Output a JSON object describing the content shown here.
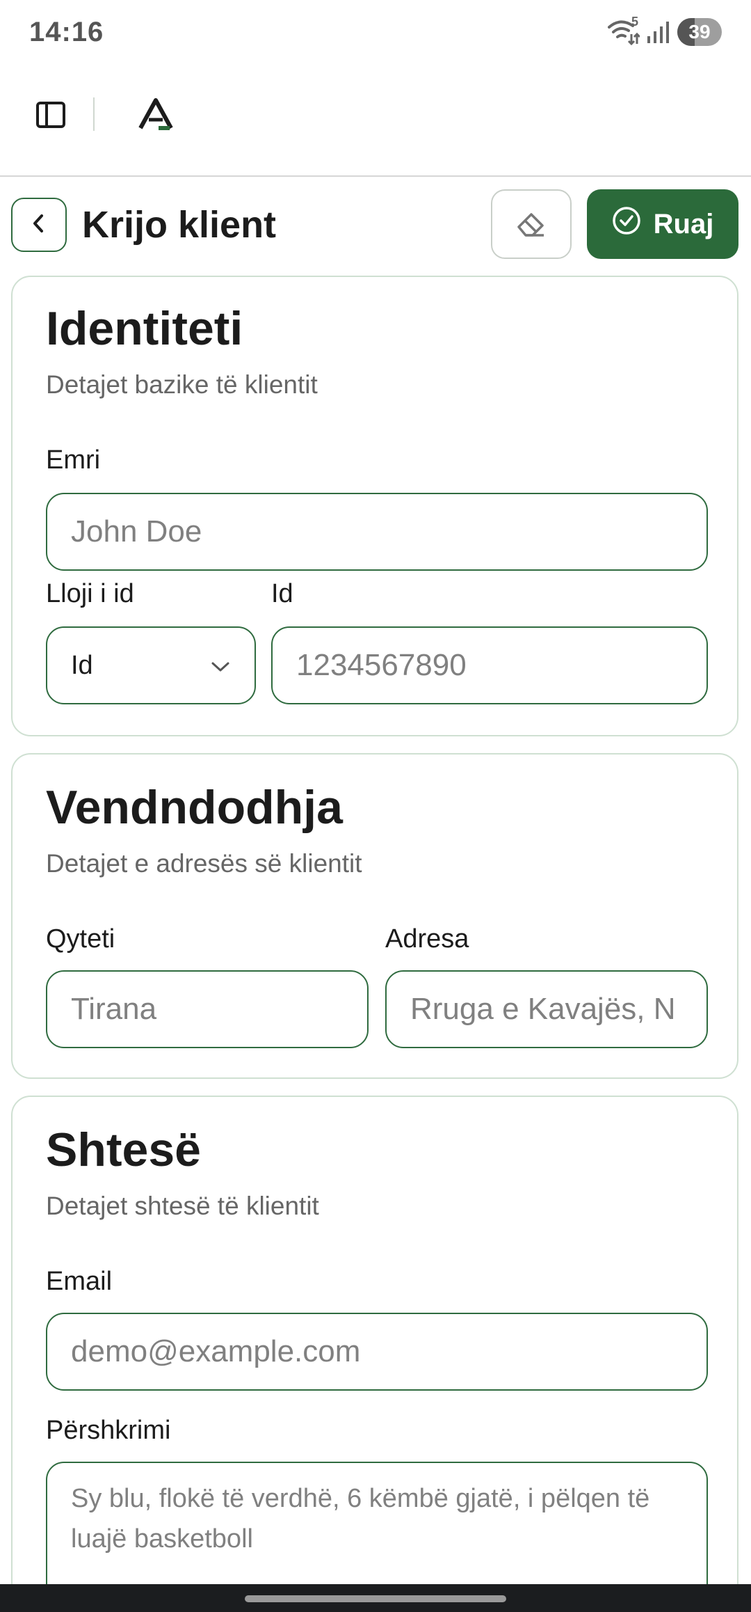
{
  "status_bar": {
    "time": "14:16",
    "wifi_badge": "5",
    "battery_level": "39",
    "battery_fraction": 0.39
  },
  "app_bar": {
    "sidebar_icon": "sidebar-toggle-icon",
    "logo_icon": "app-logo-icon"
  },
  "header": {
    "title": "Krijo klient",
    "back_icon": "chevron-left-icon",
    "clear_icon": "eraser-icon",
    "save_label": "Ruaj",
    "save_icon": "check-circle-icon"
  },
  "identity": {
    "title": "Identiteti",
    "subtitle": "Detajet bazike të klientit",
    "name_label": "Emri",
    "name_placeholder": "John Doe",
    "id_type_label": "Lloji i id",
    "id_type_value": "Id",
    "id_label": "Id",
    "id_placeholder": "1234567890"
  },
  "location": {
    "title": "Vendndodhja",
    "subtitle": "Detajet e adresës së klientit",
    "city_label": "Qyteti",
    "city_placeholder": "Tirana",
    "address_label": "Adresa",
    "address_placeholder": "Rruga e Kavajës, N"
  },
  "extra": {
    "title": "Shtesë",
    "subtitle": "Detajet shtesë të klientit",
    "email_label": "Email",
    "email_placeholder": "demo@example.com",
    "description_label": "Përshkrimi",
    "description_placeholder": "Sy blu, flokë të verdhë, 6 këmbë gjatë, i pëlqen të luajë basketboll"
  },
  "colors": {
    "accent": "#2b6a3a",
    "border": "#2f6b3f",
    "card_border": "#cfe0d2"
  }
}
